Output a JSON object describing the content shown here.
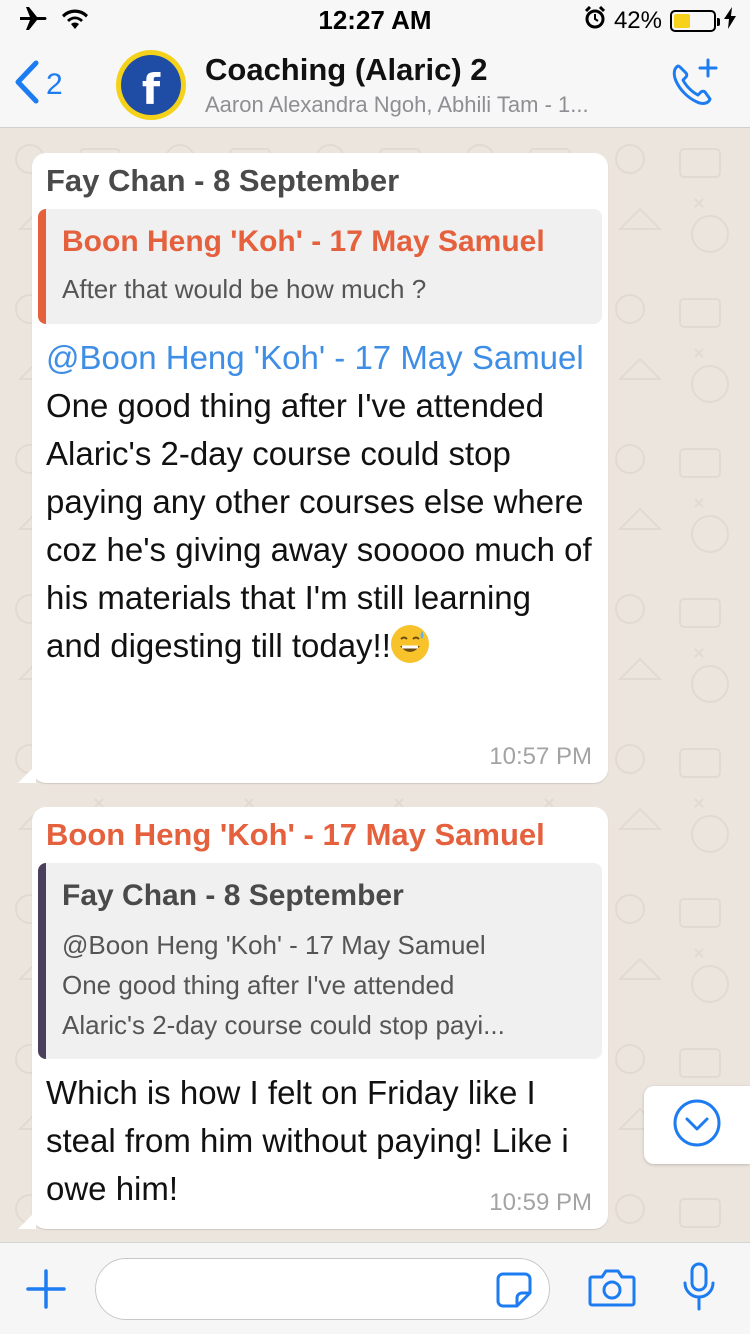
{
  "status_bar": {
    "time": "12:27 AM",
    "battery_percent": "42%",
    "battery_level": 0.42
  },
  "header": {
    "back_count": "2",
    "title": "Coaching (Alaric) 2",
    "subtitle": "Aaron Alexandra Ngoh, Abhili Tam - 1...",
    "avatar_letter": "f"
  },
  "messages": [
    {
      "sender": "Fay Chan - 8 September",
      "sender_color": "#4a4a4a",
      "quote": {
        "name": "Boon Heng 'Koh' - 17 May Samuel",
        "name_color": "#e5603c",
        "bar_color": "#e5603c",
        "text": "After that would be how much ?"
      },
      "mention": "@Boon Heng 'Koh' - 17 May Samuel",
      "text": " One good thing after I've attended Alaric's 2-day course could stop paying any other courses else where coz he's giving away sooooo much of his materials that I'm still learning and digesting till today!!",
      "time": "10:57 PM"
    },
    {
      "sender": "Boon Heng 'Koh' - 17 May Samuel",
      "sender_color": "#e5603c",
      "quote": {
        "name": "Fay Chan - 8 September",
        "name_color": "#4a4a4a",
        "bar_color": "#4b3f5e",
        "line1": "@Boon Heng 'Koh' - 17 May Samuel",
        "line2": "One good thing after I've attended",
        "line3": "Alaric's 2-day course could stop payi..."
      },
      "text": "Which is how I felt on Friday like I steal from him without paying! Like i owe him!",
      "time": "10:59 PM"
    }
  ],
  "input": {
    "placeholder": ""
  },
  "icons": {
    "airplane": "airplane-icon",
    "wifi": "wifi-icon",
    "alarm": "alarm-icon",
    "charging": "charging-icon",
    "back": "chevron-left-icon",
    "call": "add-call-icon",
    "scroll": "chevron-down-icon",
    "plus": "plus-icon",
    "sticker": "sticker-icon",
    "camera": "camera-icon",
    "mic": "microphone-icon"
  },
  "colors": {
    "accent": "#1e7cf2",
    "mention": "#3f8ee5",
    "orange_name": "#e5603c",
    "wallpaper": "#ece5dd"
  }
}
